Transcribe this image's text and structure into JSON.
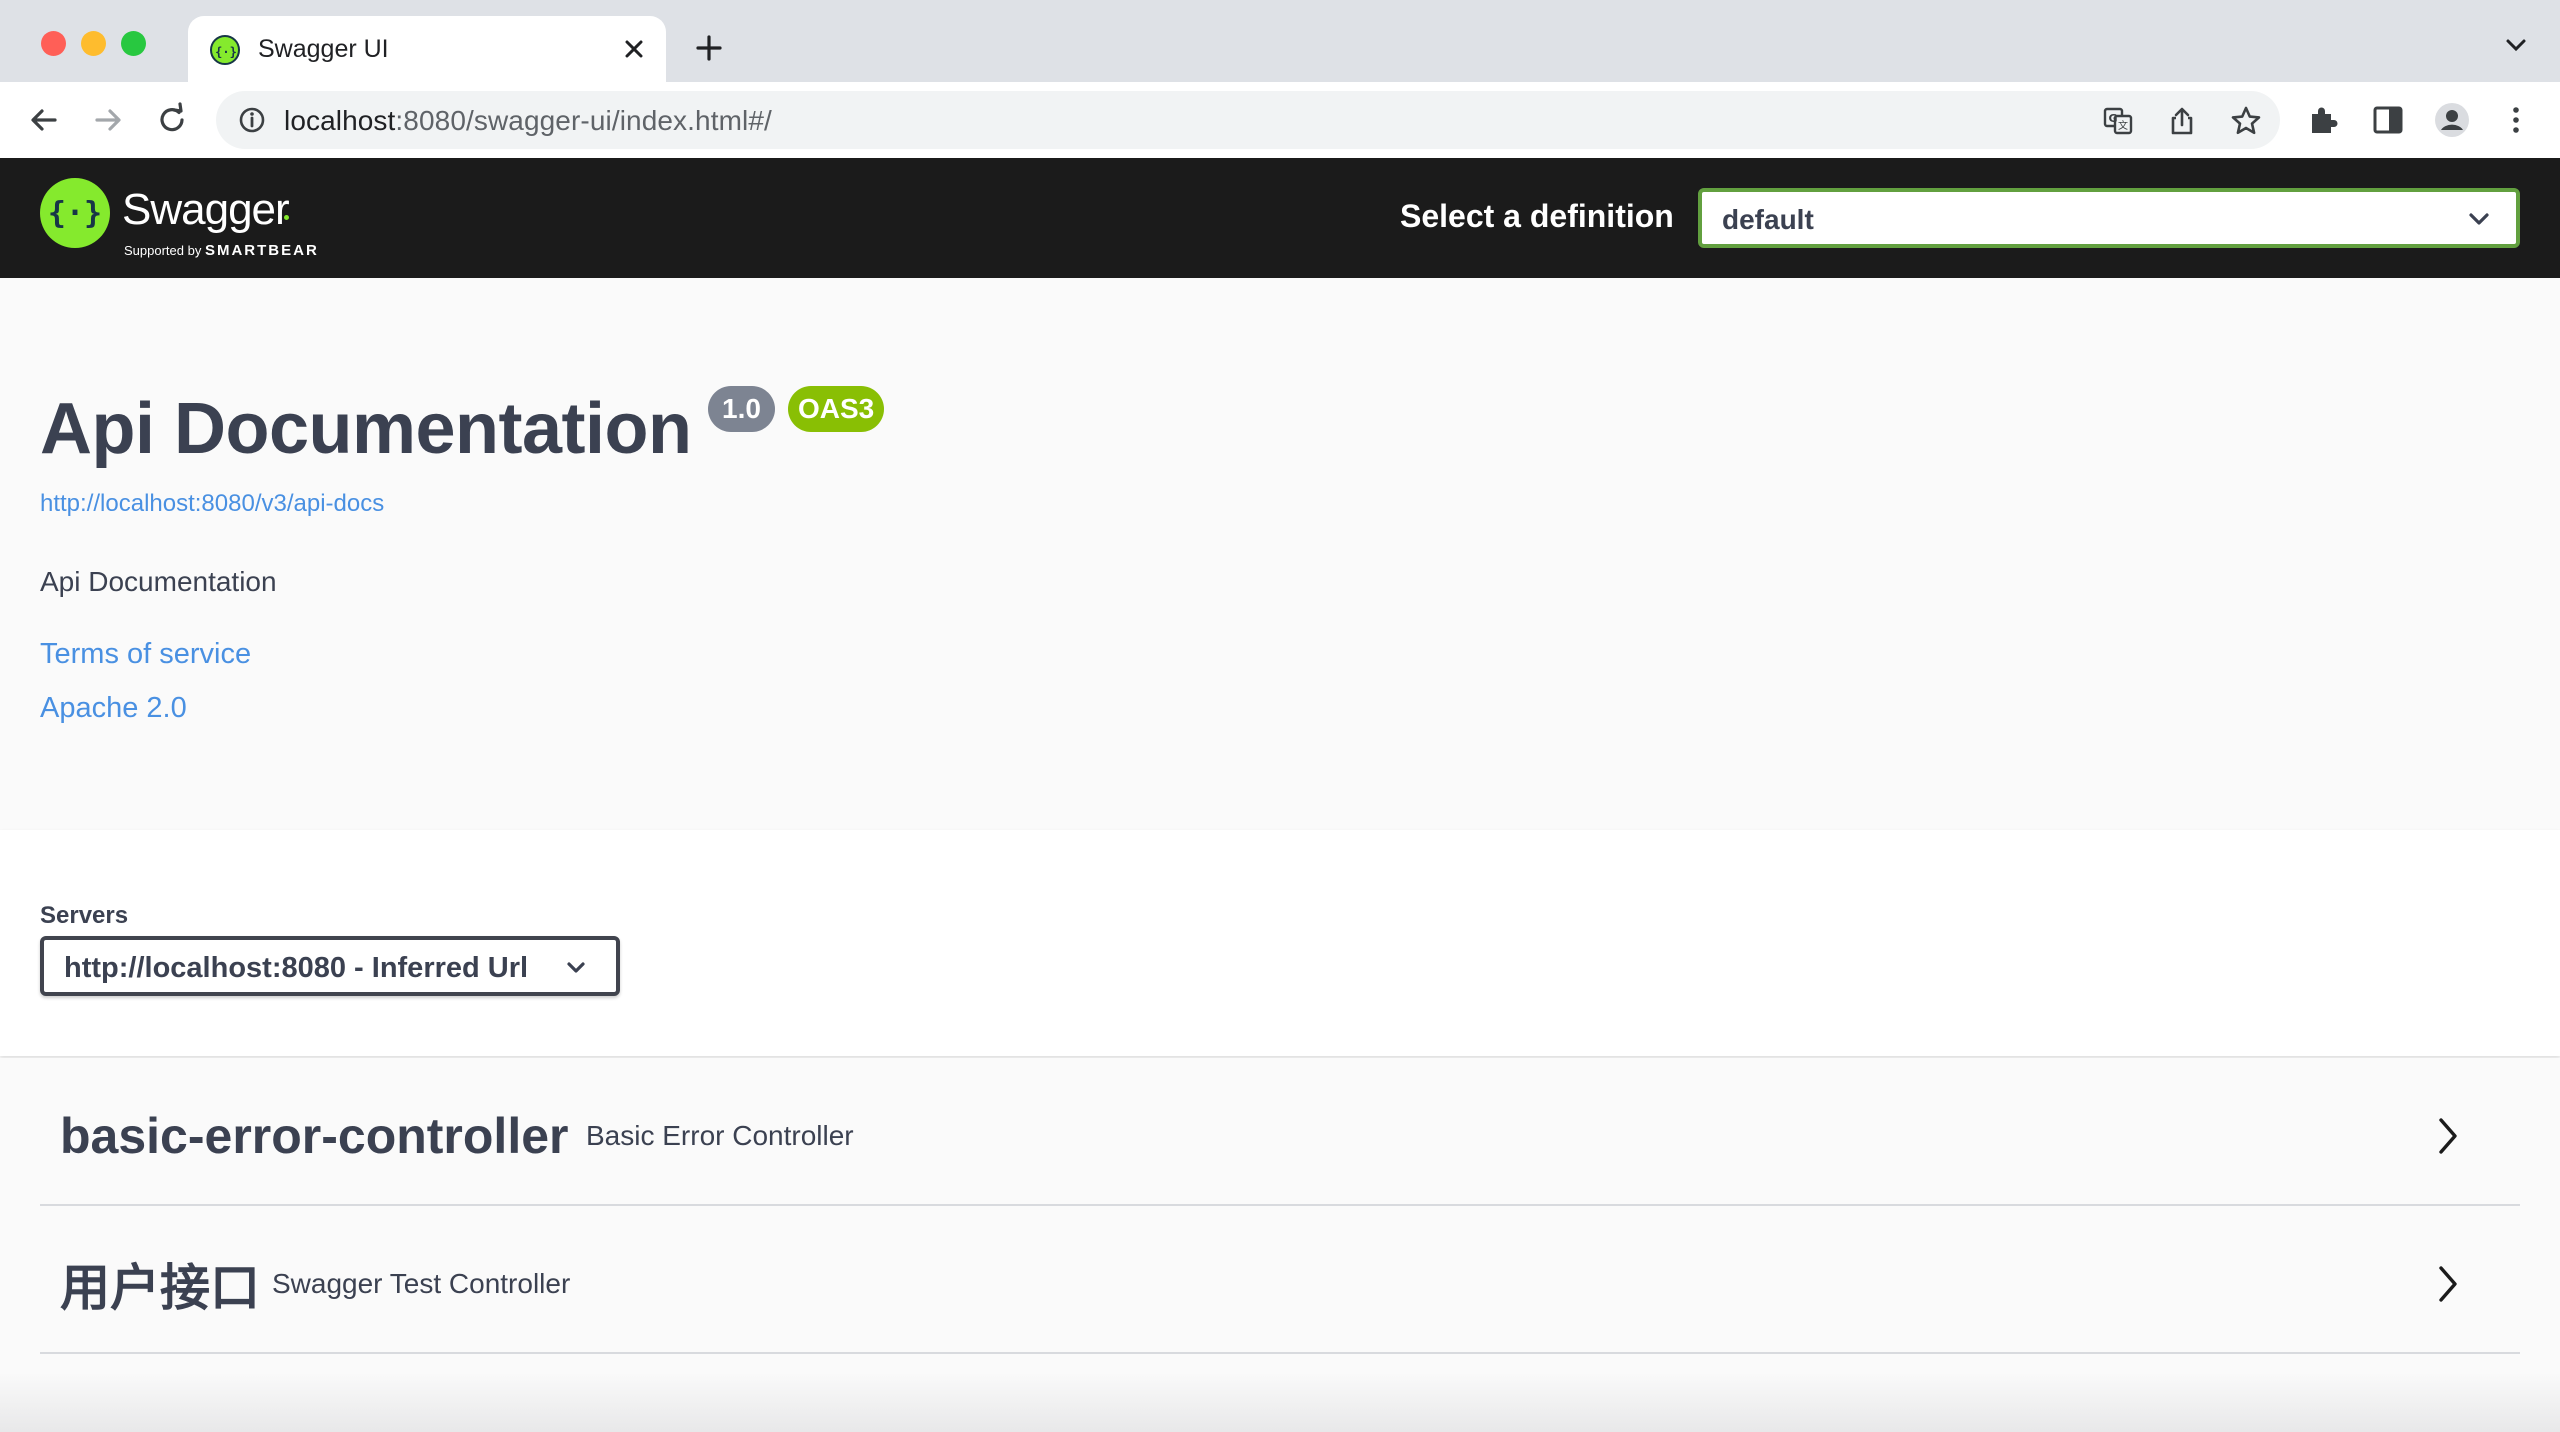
{
  "browser": {
    "tab_title": "Swagger UI",
    "url_host": "localhost",
    "url_rest": ":8080/swagger-ui/index.html#/"
  },
  "topbar": {
    "brand": "Swagger",
    "supported_by": "Supported by",
    "smartbear": "SMARTBEAR",
    "definition_label": "Select a definition",
    "definition_value": "default"
  },
  "info": {
    "title": "Api Documentation",
    "version_badge": "1.0",
    "oas_badge": "OAS3",
    "docs_url": "http://localhost:8080/v3/api-docs",
    "description": "Api Documentation",
    "terms_link": "Terms of service",
    "license_link": "Apache 2.0"
  },
  "servers": {
    "label": "Servers",
    "selected": "http://localhost:8080 - Inferred Url"
  },
  "tags": [
    {
      "name": "basic-error-controller",
      "description": "Basic Error Controller"
    },
    {
      "name": "用户接口",
      "description": "Swagger Test Controller"
    }
  ],
  "colors": {
    "swagger_green": "#85ea2d",
    "topbar_bg": "#1b1b1b",
    "link_blue": "#4990e2",
    "text_dark": "#3b4151",
    "version_badge": "#7d8492",
    "oas_badge": "#89bf04"
  },
  "icons": {
    "back": "arrow-left-icon",
    "forward": "arrow-right-icon",
    "reload": "reload-icon",
    "info": "info-icon",
    "translate": "translate-icon",
    "share": "share-icon",
    "bookmark": "star-icon",
    "extensions": "puzzle-icon",
    "side_panel": "side-panel-icon",
    "profile": "profile-icon",
    "menu": "kebab-menu-icon"
  }
}
